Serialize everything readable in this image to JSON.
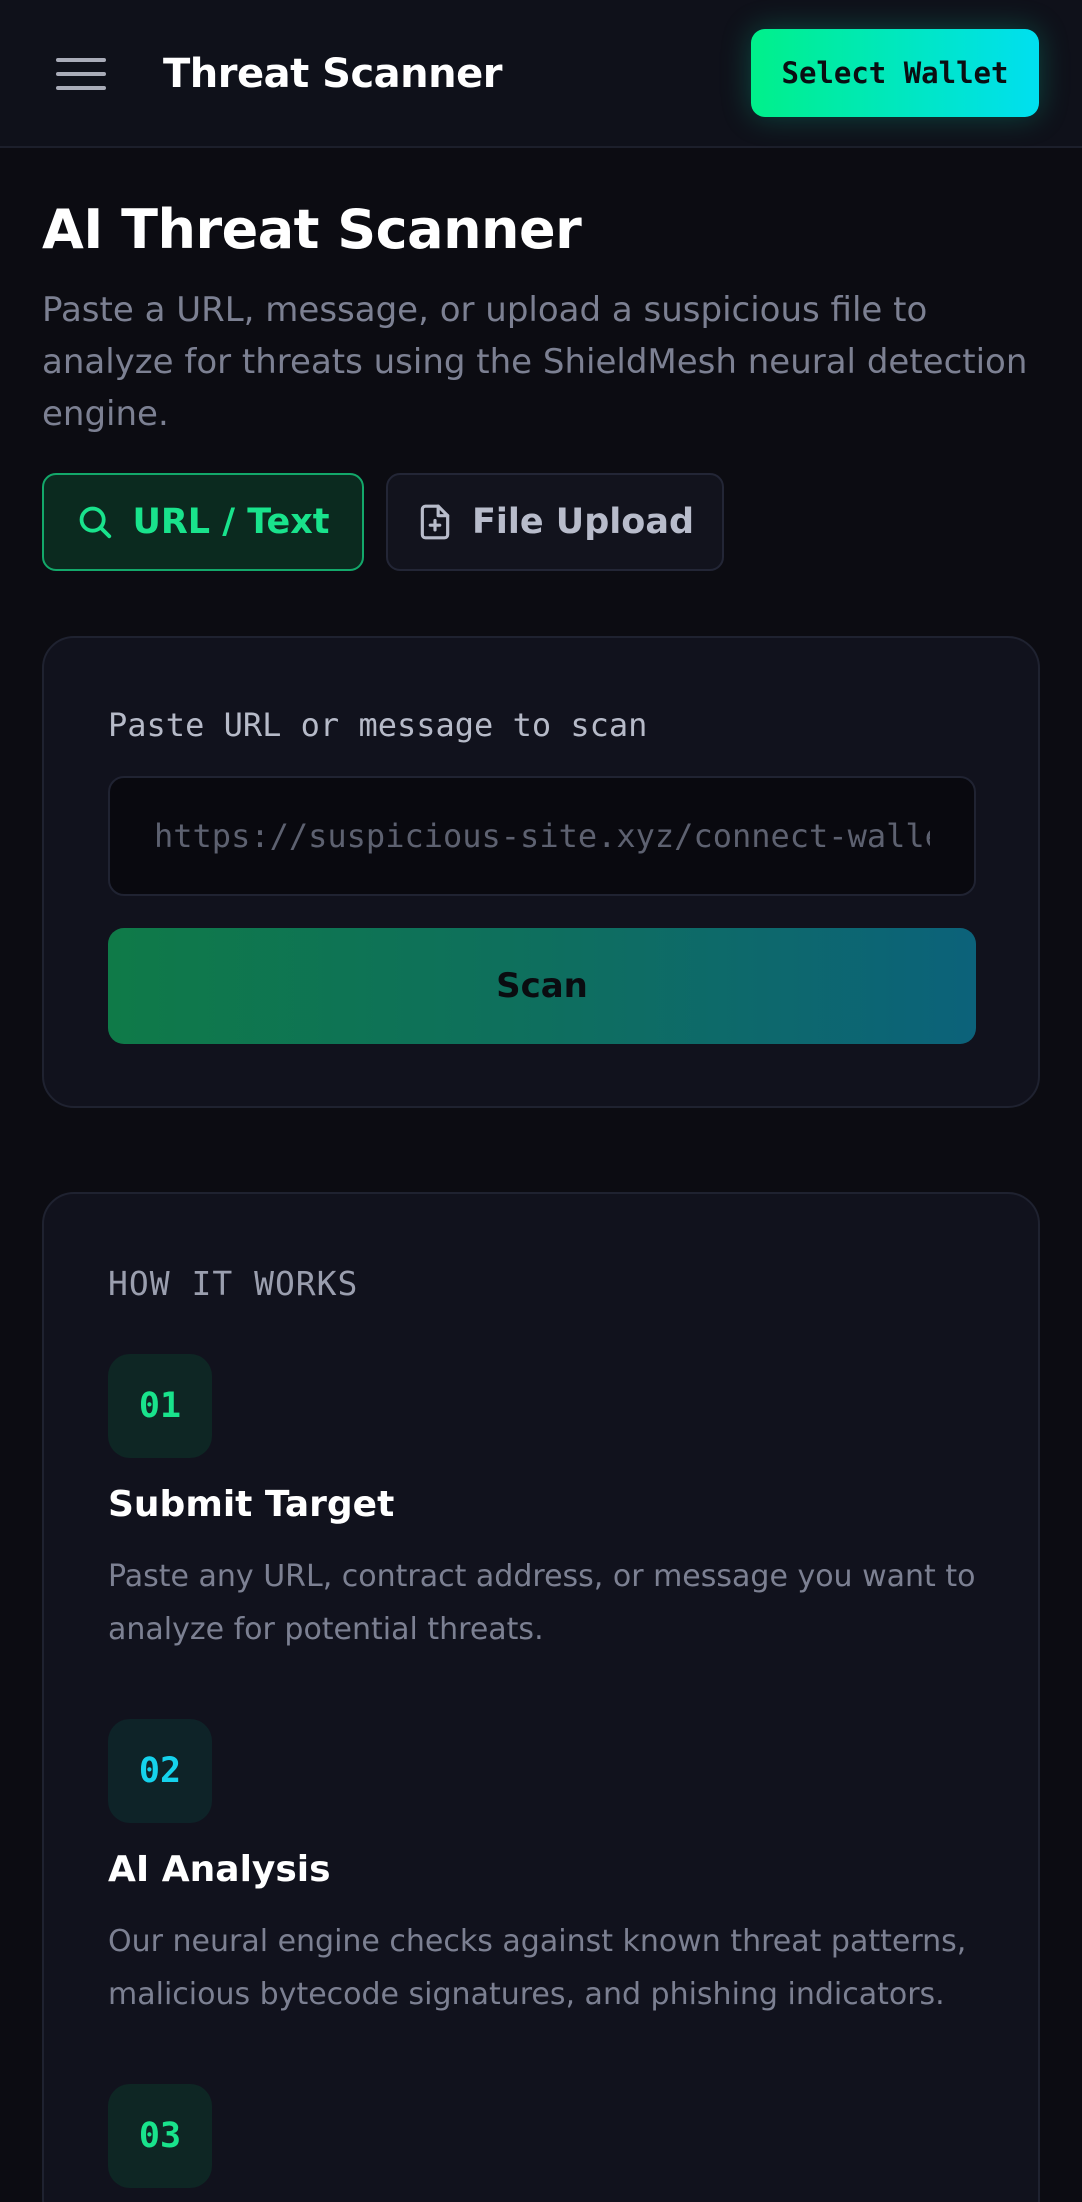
{
  "header": {
    "title": "Threat Scanner",
    "wallet_button": "Select Wallet"
  },
  "page": {
    "title": "AI Threat Scanner",
    "description": "Paste a URL, message, or upload a suspicious file to analyze for threats using the ShieldMesh neural detection engine."
  },
  "tabs": [
    {
      "label": "URL / Text",
      "icon": "search-icon",
      "active": true
    },
    {
      "label": "File Upload",
      "icon": "file-plus-icon",
      "active": false
    }
  ],
  "scan_form": {
    "label": "Paste URL or message to scan",
    "input_placeholder": "https://suspicious-site.xyz/connect-wallet",
    "input_value": "",
    "scan_button": "Scan"
  },
  "how_it_works": {
    "heading": "HOW IT WORKS",
    "steps": [
      {
        "number": "01",
        "title": "Submit Target",
        "description": "Paste any URL, contract address, or message you want to analyze for potential threats."
      },
      {
        "number": "02",
        "title": "AI Analysis",
        "description": "Our neural engine checks against known threat patterns, malicious bytecode signatures, and phishing indicators."
      },
      {
        "number": "03"
      }
    ]
  },
  "colors": {
    "accent_green": "#19e38c",
    "accent_cyan": "#15d2ec",
    "background": "#0c0c12",
    "card": "#11121d"
  }
}
